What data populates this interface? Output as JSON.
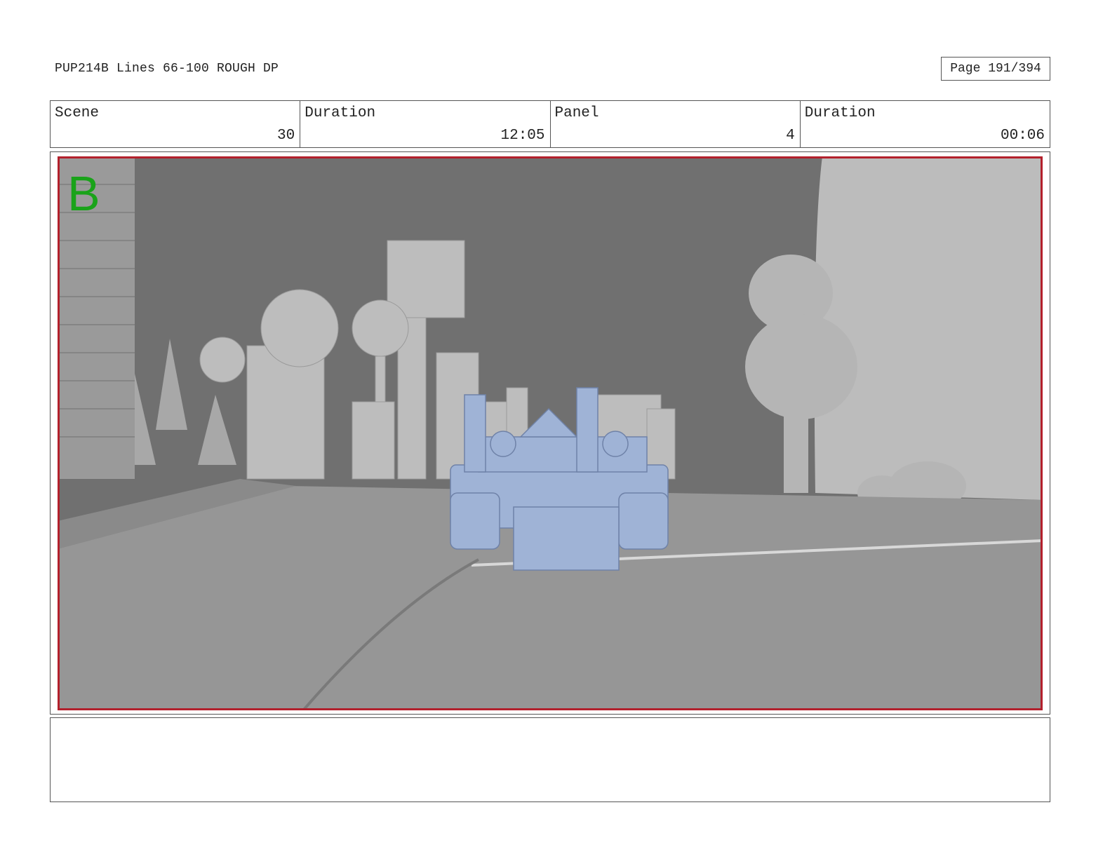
{
  "header": {
    "title": "PUP214B Lines 66-100 ROUGH DP",
    "page": "Page 191/394"
  },
  "info": {
    "scene_label": "Scene",
    "scene_value": "30",
    "scene_duration_label": "Duration",
    "scene_duration_value": "12:05",
    "panel_label": "Panel",
    "panel_value": "4",
    "panel_duration_label": "Duration",
    "panel_duration_value": "00:06"
  },
  "panel": {
    "letter": "B",
    "letter_color": "#1aa31a",
    "frame_color": "#b3202c",
    "vehicle_color": "#9fb3d6"
  },
  "notes": {
    "text": ""
  }
}
